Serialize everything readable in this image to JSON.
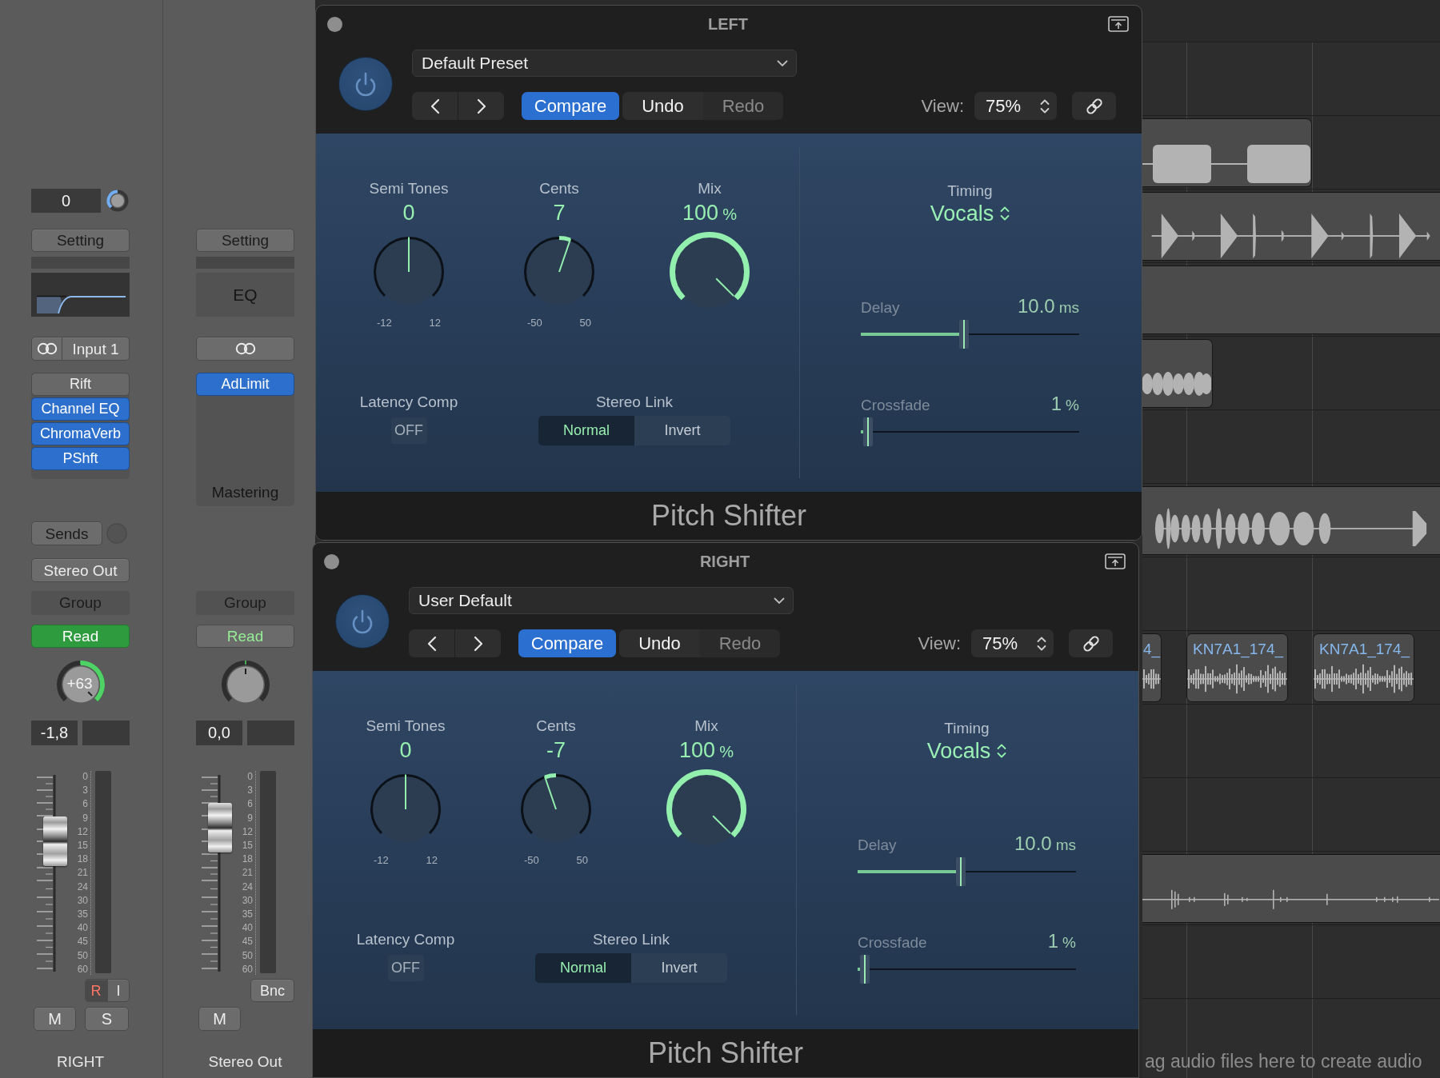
{
  "mixer": {
    "channels": [
      {
        "input_gain": {
          "value": "0"
        },
        "setting": "Setting",
        "eq": {
          "kind": "curve"
        },
        "input": {
          "label": "Input 1"
        },
        "inserts": [
          {
            "label": "Rift",
            "bypassed": true
          },
          {
            "label": "Channel EQ",
            "bypassed": false
          },
          {
            "label": "ChromaVerb",
            "bypassed": false
          },
          {
            "label": "PShft",
            "bypassed": false
          }
        ],
        "sends": "Sends",
        "output": "Stereo Out",
        "group": "Group",
        "automation": {
          "label": "Read",
          "active": true
        },
        "pan": {
          "value": "+63"
        },
        "volume": "-1,8",
        "fader": {
          "level": 0.665
        },
        "meter_scale": [
          "0",
          "3",
          "6",
          "9",
          "12",
          "15",
          "18",
          "21",
          "24",
          "30",
          "35",
          "40",
          "45",
          "50",
          "60"
        ],
        "buttons": [
          {
            "kind": "record",
            "label": "R"
          },
          {
            "kind": "input",
            "label": "I"
          }
        ],
        "mute": "M",
        "solo": "S",
        "name": "RIGHT"
      },
      {
        "setting": "Setting",
        "eq": {
          "kind": "label",
          "label": "EQ"
        },
        "inserts": [
          {
            "label": "AdLimit",
            "bypassed": false
          }
        ],
        "slot_label": "Mastering",
        "group": "Group",
        "automation": {
          "label": "Read",
          "active": false
        },
        "volume": "0,0",
        "fader": {
          "level": 0.736
        },
        "meter_scale": [
          "0",
          "3",
          "6",
          "9",
          "12",
          "15",
          "18",
          "21",
          "24",
          "30",
          "35",
          "40",
          "45",
          "50",
          "60"
        ],
        "buttons": [
          {
            "kind": "bounce",
            "label": "Bnc"
          }
        ],
        "mute": "M",
        "name": "Stereo Out"
      }
    ]
  },
  "plugin_windows": [
    {
      "title": "LEFT",
      "preset": "Default Preset",
      "toolbar": [
        {
          "label": "Compare",
          "active": true,
          "disabled": false
        },
        {
          "label": "Undo",
          "active": false,
          "disabled": false
        },
        {
          "label": "Redo",
          "active": false,
          "disabled": true
        }
      ],
      "view": {
        "label": "View:",
        "value": "75%"
      },
      "knobs": [
        {
          "kind": "bipolar",
          "label": "Semi Tones",
          "value": "0",
          "min": "-12",
          "max": "12"
        },
        {
          "kind": "bipolar",
          "label": "Cents",
          "value": "7",
          "min": "-50",
          "max": "50"
        },
        {
          "kind": "unipolar",
          "label": "Mix",
          "value": "100",
          "unit": "%"
        }
      ],
      "latency_comp": {
        "label": "Latency Comp",
        "value": "OFF"
      },
      "stereo_link": {
        "label": "Stereo Link",
        "options": [
          {
            "label": "Normal",
            "selected": true
          },
          {
            "label": "Invert",
            "selected": false
          }
        ]
      },
      "timing": {
        "label": "Timing",
        "value": "Vocals"
      },
      "sliders": [
        {
          "label": "Delay",
          "value": "10.0",
          "unit": "ms",
          "level": 0.47
        },
        {
          "label": "Crossfade",
          "value": "1",
          "unit": "%",
          "level": 0.01
        }
      ],
      "plugin_name": "Pitch Shifter"
    },
    {
      "title": "RIGHT",
      "preset": "User Default",
      "toolbar": [
        {
          "label": "Compare",
          "active": true,
          "disabled": false
        },
        {
          "label": "Undo",
          "active": false,
          "disabled": false
        },
        {
          "label": "Redo",
          "active": false,
          "disabled": true
        }
      ],
      "view": {
        "label": "View:",
        "value": "75%"
      },
      "knobs": [
        {
          "kind": "bipolar",
          "label": "Semi Tones",
          "value": "0",
          "min": "-12",
          "max": "12"
        },
        {
          "kind": "bipolar",
          "label": "Cents",
          "value": "-7",
          "min": "-50",
          "max": "50"
        },
        {
          "kind": "unipolar",
          "label": "Mix",
          "value": "100",
          "unit": "%"
        }
      ],
      "latency_comp": {
        "label": "Latency Comp",
        "value": "OFF"
      },
      "stereo_link": {
        "label": "Stereo Link",
        "options": [
          {
            "label": "Normal",
            "selected": true
          },
          {
            "label": "Invert",
            "selected": false
          }
        ]
      },
      "timing": {
        "label": "Timing",
        "value": "Vocals"
      },
      "sliders": [
        {
          "label": "Delay",
          "value": "10.0",
          "unit": "ms",
          "level": 0.47
        },
        {
          "label": "Crossfade",
          "value": "1",
          "unit": "%",
          "level": 0.01
        }
      ],
      "plugin_name": "Pitch Shifter"
    }
  ],
  "arrange": {
    "regions": [
      {
        "name": "4_"
      },
      {
        "name": "KN7A1_174_"
      },
      {
        "name": "KN7A1_174_"
      }
    ],
    "hint": "ag audio files here to create audio"
  }
}
